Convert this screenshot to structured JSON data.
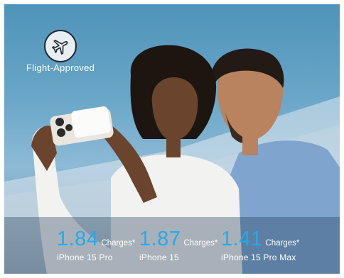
{
  "badge": {
    "icon": "airplane-icon",
    "label": "Flight-Approved"
  },
  "stats": [
    {
      "value": "1.84",
      "unit": "Charges*",
      "model": "iPhone 15 Pro"
    },
    {
      "value": "1.87",
      "unit": "Charges*",
      "model": "iPhone 15"
    },
    {
      "value": "1.41",
      "unit": "Charges*",
      "model": "iPhone 15 Pro Max"
    }
  ],
  "colors": {
    "accent": "#27a9e9",
    "sky": "#5d9dc1"
  }
}
